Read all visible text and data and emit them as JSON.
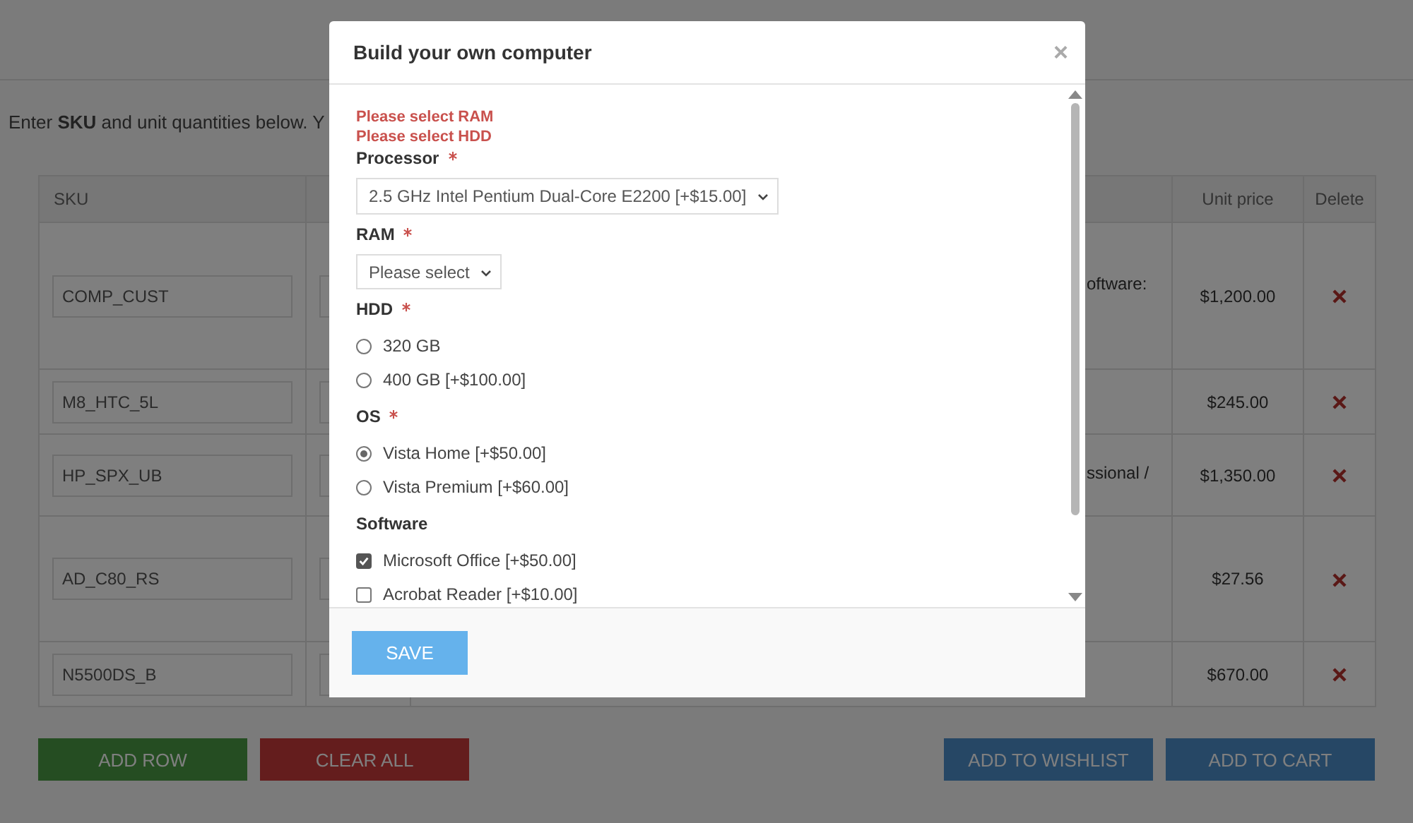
{
  "intro": "Enter **SKU** and unit quantities below. Y",
  "table": {
    "headers": {
      "sku": "SKU",
      "unit_price": "Unit price",
      "delete": "Delete"
    },
    "rows": [
      {
        "sku": "COMP_CUST",
        "column_3": "oftware:",
        "unit_price": "$1,200.00"
      },
      {
        "sku": "M8_HTC_5L",
        "unit_price": "$245.00"
      },
      {
        "sku": "HP_SPX_UB",
        "column_3": "ssional /",
        "unit_price": "$1,350.00"
      },
      {
        "sku": "AD_C80_RS",
        "unit_price": "$27.56"
      },
      {
        "sku": "N5500DS_B",
        "unit_price": "$670.00"
      }
    ]
  },
  "buttons_left": [
    {
      "label": "ADD ROW",
      "kind": "success"
    },
    {
      "label": "CLEAR ALL",
      "kind": "danger"
    }
  ],
  "buttons_right": [
    {
      "label": "ADD TO WISHLIST",
      "kind": "primary"
    },
    {
      "label": "ADD TO CART",
      "kind": "primary"
    }
  ],
  "modal": {
    "title": "Build your own computer",
    "close": "×",
    "errors": [
      "Please select RAM",
      "Please select HDD"
    ],
    "fields": [
      {
        "kind": "select",
        "label": "Processor",
        "required": true,
        "value": "2.5 GHz Intel Pentium Dual-Core E2200 [+$15.00]",
        "wide": true
      },
      {
        "kind": "select",
        "label": "RAM",
        "required": true,
        "value": "Please select",
        "wide": false
      },
      {
        "kind": "radio",
        "label": "HDD",
        "required": true,
        "options": [
          {
            "label": "320 GB",
            "selected": false
          },
          {
            "label": "400 GB [+$100.00]",
            "selected": false
          }
        ]
      },
      {
        "kind": "radio",
        "label": "OS",
        "required": true,
        "options": [
          {
            "label": "Vista Home [+$50.00]",
            "selected": true
          },
          {
            "label": "Vista Premium [+$60.00]",
            "selected": false
          }
        ]
      },
      {
        "kind": "checkbox",
        "label": "Software",
        "required": false,
        "options": [
          {
            "label": "Microsoft Office [+$50.00]",
            "checked": true
          },
          {
            "label": "Acrobat Reader [+$10.00]",
            "checked": false
          }
        ]
      }
    ],
    "save": "SAVE"
  }
}
